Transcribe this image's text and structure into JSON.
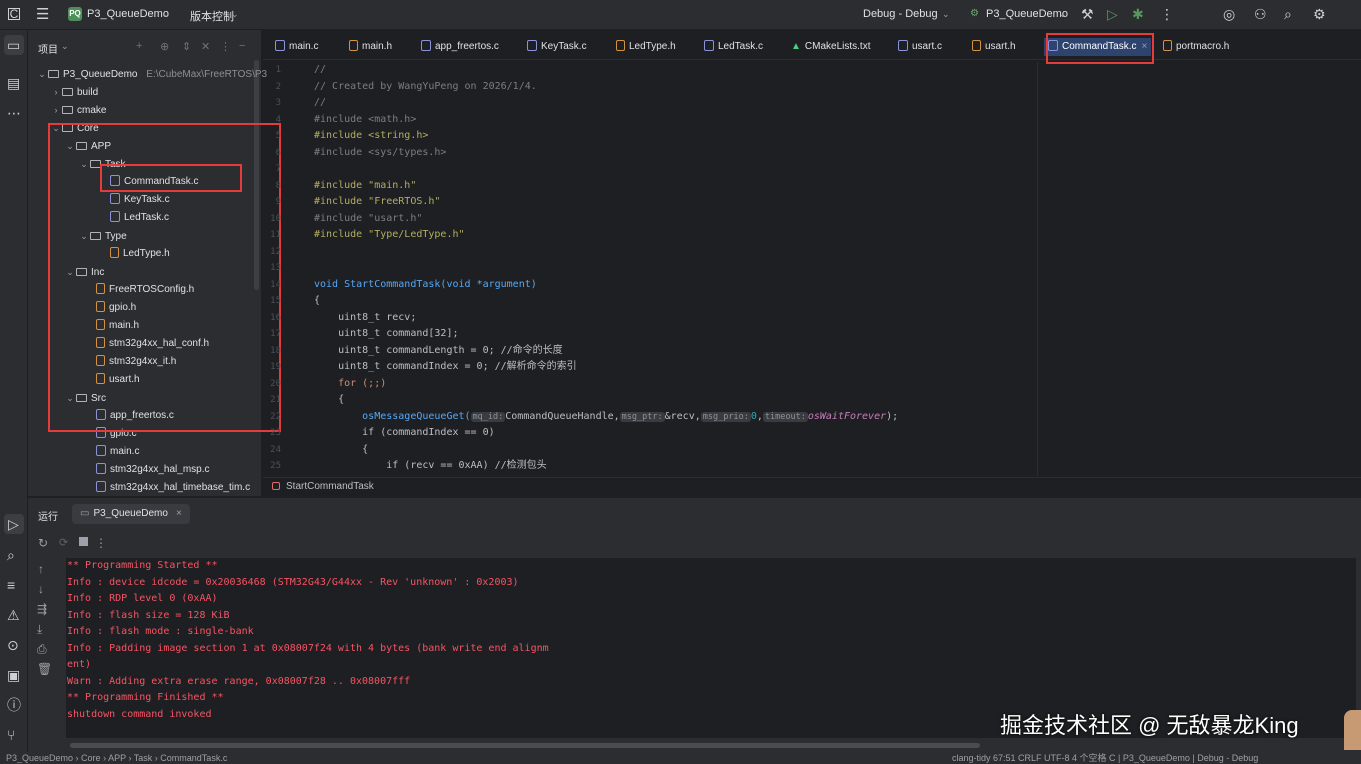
{
  "titlebar": {
    "project_badge": "PQ",
    "project_name": "P3_QueueDemo",
    "vcs_label": "版本控制",
    "config": "Debug - Debug",
    "target": "P3_QueueDemo"
  },
  "project_panel": {
    "title": "项目",
    "root_name": "P3_QueueDemo",
    "root_path": "E:\\CubeMax\\FreeRTOS\\P3",
    "items": [
      {
        "label": "build"
      },
      {
        "label": "cmake"
      },
      {
        "label": "Core"
      },
      {
        "label": "APP"
      },
      {
        "label": "Task"
      },
      {
        "label": "CommandTask.c"
      },
      {
        "label": "KeyTask.c"
      },
      {
        "label": "LedTask.c"
      },
      {
        "label": "Type"
      },
      {
        "label": "LedType.h"
      },
      {
        "label": "Inc"
      },
      {
        "label": "FreeRTOSConfig.h"
      },
      {
        "label": "gpio.h"
      },
      {
        "label": "main.h"
      },
      {
        "label": "stm32g4xx_hal_conf.h"
      },
      {
        "label": "stm32g4xx_it.h"
      },
      {
        "label": "usart.h"
      },
      {
        "label": "Src"
      },
      {
        "label": "app_freertos.c"
      },
      {
        "label": "gpio.c"
      },
      {
        "label": "main.c"
      },
      {
        "label": "stm32g4xx_hal_msp.c"
      },
      {
        "label": "stm32g4xx_hal_timebase_tim.c"
      }
    ]
  },
  "tabs": [
    {
      "label": "main.c"
    },
    {
      "label": "main.h"
    },
    {
      "label": "app_freertos.c"
    },
    {
      "label": "KeyTask.c"
    },
    {
      "label": "LedType.h"
    },
    {
      "label": "LedTask.c"
    },
    {
      "label": "CMakeLists.txt"
    },
    {
      "label": "usart.c"
    },
    {
      "label": "usart.h"
    },
    {
      "label": "CommandTask.c"
    },
    {
      "label": "portmacro.h"
    }
  ],
  "code": {
    "lines": [
      "//",
      "// Created by WangYuPeng on 2026/1/4.",
      "//",
      "#include <math.h>",
      "#include <string.h>",
      "#include <sys/types.h>",
      "",
      "#include \"main.h\"",
      "#include \"FreeRTOS.h\"",
      "#include \"usart.h\"",
      "#include \"Type/LedType.h\"",
      "",
      "",
      "void StartCommandTask(void *argument)",
      "{",
      "    uint8_t recv;",
      "    uint8_t command[32];",
      "    uint8_t commandLength = 0; //命令的长度",
      "    uint8_t commandIndex = 0; //解析命令的索引",
      "    for (;;)",
      "    {",
      "        osMessageQueueGet(",
      "        if (commandIndex == 0)",
      "        {",
      "            if (recv == 0xAA) //检测包头"
    ],
    "hint_mq_id": "mq_id:",
    "hint_msg_ptr": "msg_ptr:",
    "hint_msg_prio": "msg_prio:",
    "hint_timeout": "timeout:",
    "arg_queue": "CommandQueueHandle",
    "arg_recv": "&recv",
    "arg_prio": "0",
    "arg_wait": "osWaitForever",
    "close_paren": ");"
  },
  "breadcrumb_func": "StartCommandTask",
  "run_panel": {
    "title": "运行",
    "tab_label": "P3_QueueDemo",
    "output": [
      "** Programming Started **",
      "Info : device idcode = 0x20036468 (STM32G43/G44xx - Rev 'unknown' : 0x2003)",
      "Info : RDP level 0 (0xAA)",
      "Info : flash size = 128 KiB",
      "Info : flash mode : single-bank",
      "Info : Padding image section 1 at 0x08007f24 with 4 bytes (bank write end alignm",
      "ent)",
      "Warn : Adding extra erase range, 0x08007f28 .. 0x08007fff",
      "** Programming Finished **",
      "shutdown command invoked"
    ]
  },
  "watermark": "掘金技术社区 @ 无敌暴龙King",
  "statusbar": {
    "path": [
      "P3_QueueDemo",
      "Core",
      "APP",
      "Task",
      "CommandTask.c"
    ],
    "right": "clang-tidy   67:51   CRLF   UTF-8   4 个空格   C | P3_QueueDemo | Debug - Debug"
  }
}
